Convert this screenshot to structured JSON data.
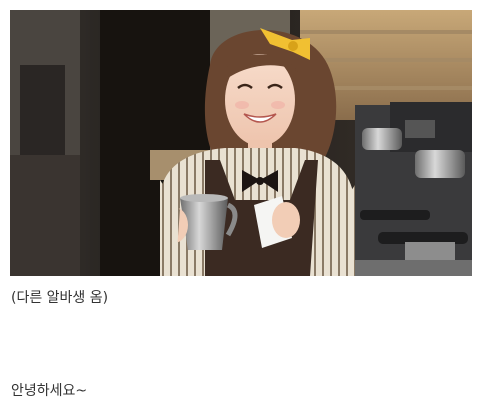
{
  "post": {
    "photo": {
      "subject": "barista-smiling-holding-milk-pitcher"
    },
    "caption": "(다른 알바생 옴)",
    "greeting": "안녕하세요~"
  }
}
